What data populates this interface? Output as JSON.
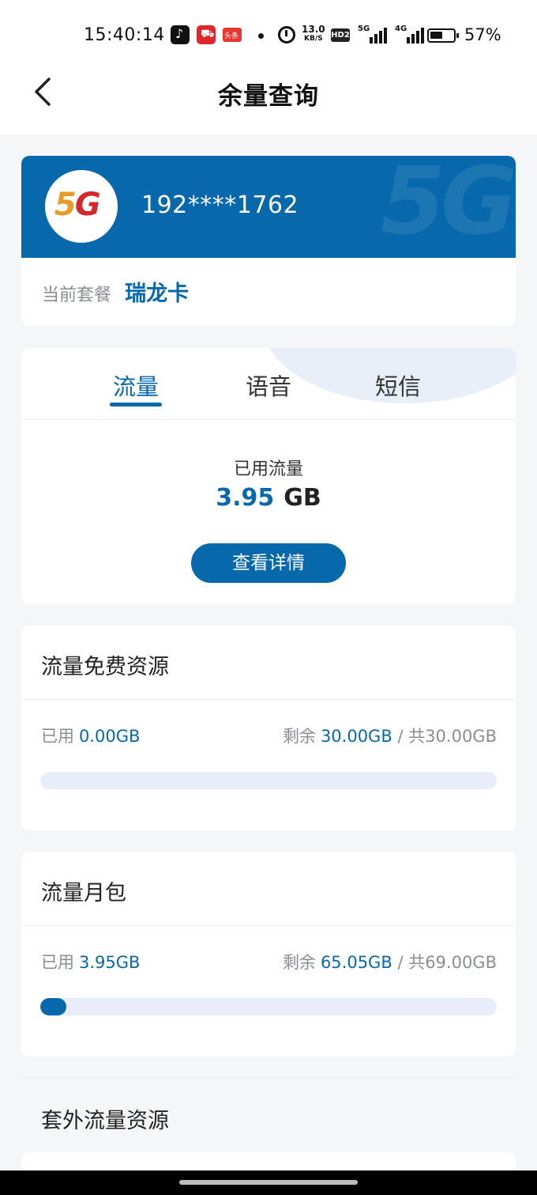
{
  "status_bar": {
    "time": "15:40:14",
    "news_badge": "头条",
    "speed_value": "13.0",
    "speed_unit": "KB/S",
    "hd_label": "HD2",
    "signal_1_label": "5G",
    "signal_2_label": "4G",
    "battery_percent": "57%",
    "battery_level": 0.57
  },
  "nav": {
    "title": "余量查询"
  },
  "account": {
    "logo_text_5": "5",
    "logo_text_g": "G",
    "phone": "192****1762",
    "plan_label": "当前套餐",
    "plan_name": "瑞龙卡"
  },
  "usage": {
    "tabs": [
      "流量",
      "语音",
      "短信"
    ],
    "active_tab": 0,
    "used_label": "已用流量",
    "used_value": "3.95",
    "used_unit": "GB",
    "detail_button": "查看详情"
  },
  "resources": [
    {
      "title": "流量免费资源",
      "used_label": "已用",
      "used_value": "0.00GB",
      "remain_label": "剩余",
      "remain_value": "30.00GB",
      "total_text": "/ 共30.00GB",
      "progress": 0.0
    },
    {
      "title": "流量月包",
      "used_label": "已用",
      "used_value": "3.95GB",
      "remain_label": "剩余",
      "remain_value": "65.05GB",
      "total_text": "/ 共69.00GB",
      "progress": 0.057
    }
  ],
  "extra": {
    "title": "套外流量资源"
  },
  "colors": {
    "brand_blue": "#0868ac",
    "track": "#e8edf9"
  }
}
